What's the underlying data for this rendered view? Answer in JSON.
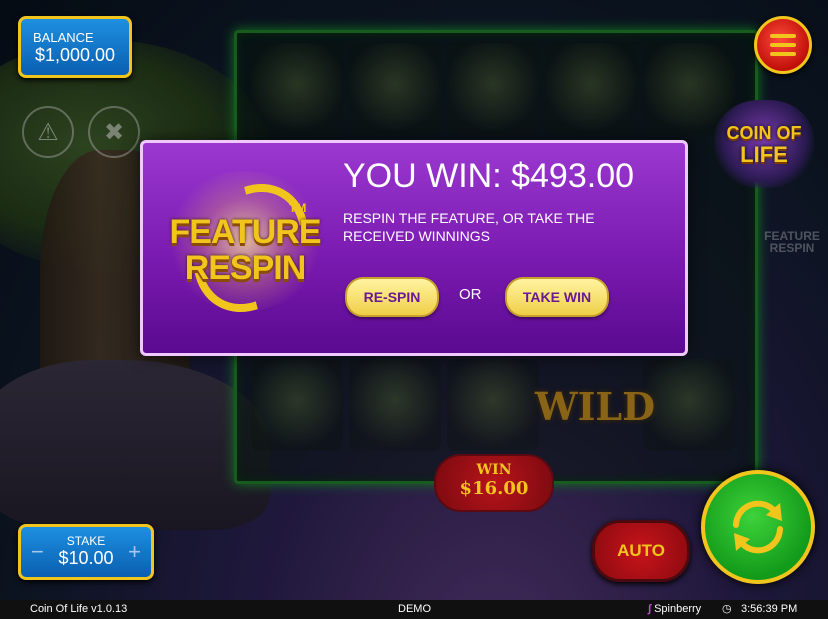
{
  "balance": {
    "label": "BALANCE",
    "value": "$1,000.00"
  },
  "stake": {
    "label": "STAKE",
    "value": "$10.00",
    "minus": "−",
    "plus": "+"
  },
  "logo": {
    "line1": "COIN OF",
    "line2": "LIFE"
  },
  "side_feature": {
    "line1": "FEATURE",
    "line2": "RESPIN"
  },
  "reels": {
    "wild_label": "WILD"
  },
  "win_display": {
    "label": "WIN",
    "value": "$16.00"
  },
  "auto_label": "AUTO",
  "popup": {
    "badge_line1": "FEATURE",
    "badge_line2": "RESPIN",
    "badge_tm": "TM",
    "title": "YOU WIN: $493.00",
    "description": "RESPIN THE FEATURE, OR TAKE THE RECEIVED WINNINGS",
    "respin_label": "RE-SPIN",
    "or_label": "OR",
    "take_win_label": "TAKE WIN"
  },
  "footer": {
    "game_title": "Coin Of Life v1.0.13",
    "mode": "DEMO",
    "brand": "Spinberry",
    "time": "3:56:39 PM"
  },
  "icons": {
    "warning": "warning-icon",
    "tools": "tools-icon",
    "menu": "hamburger-menu-icon",
    "spin": "spin-arrows-icon",
    "clock": "clock-icon"
  },
  "colors": {
    "accent_gold": "#f2c51c",
    "popup_purple": "#7a1ab0",
    "spin_green": "#129a1a",
    "auto_red": "#c8141a",
    "pill_blue": "#0a5fb0"
  }
}
